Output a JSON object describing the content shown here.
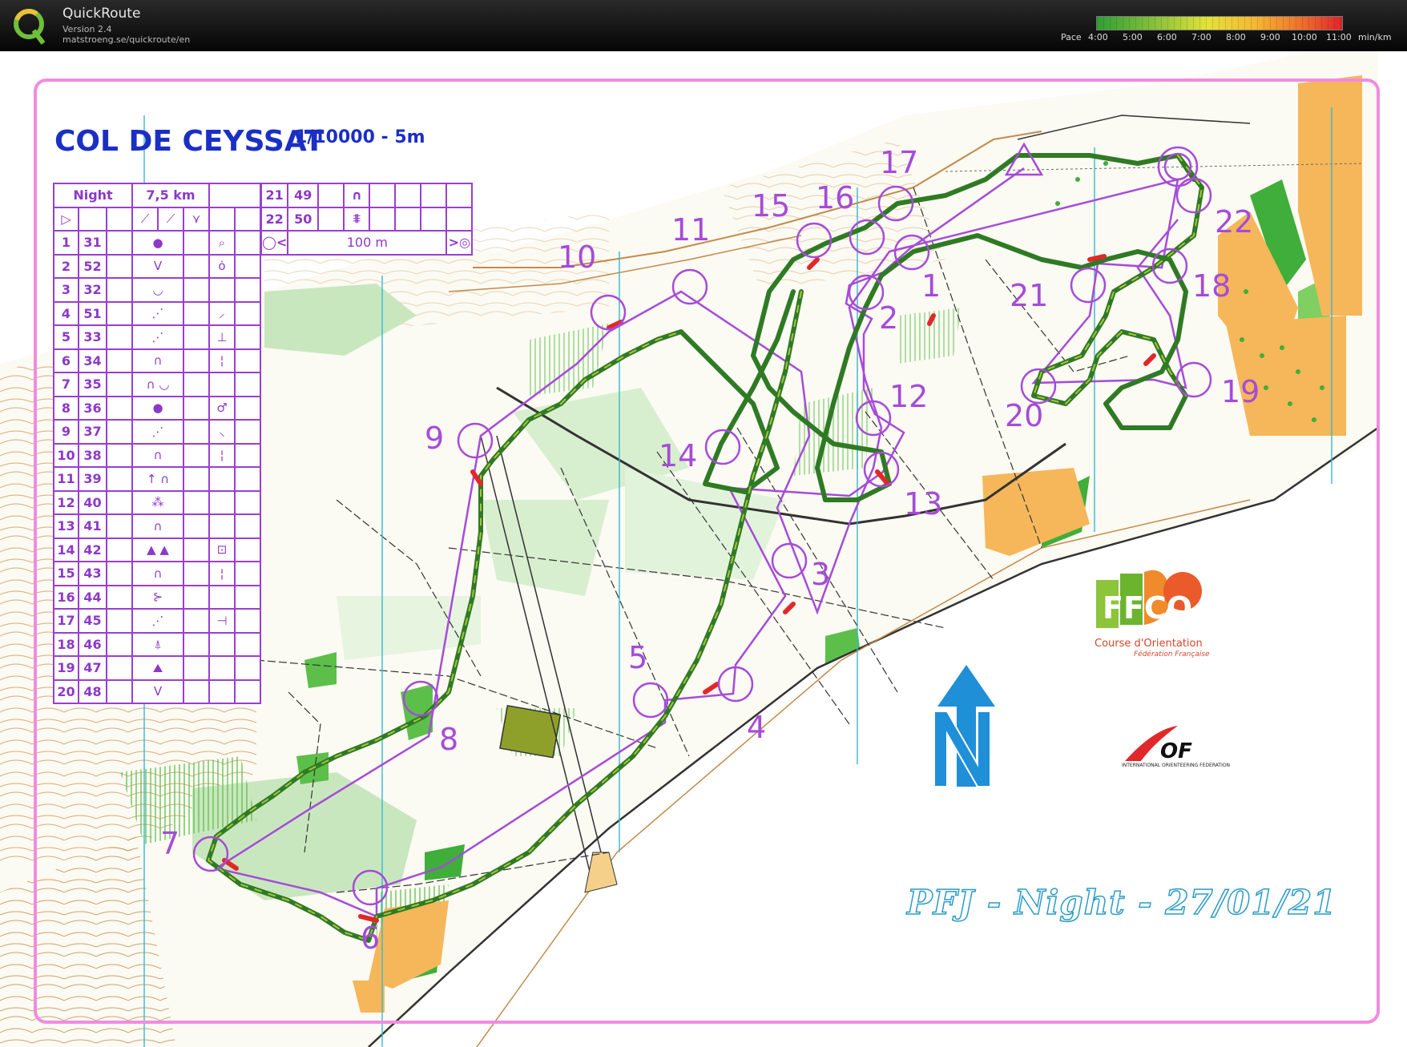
{
  "app": {
    "title": "QuickRoute",
    "version": "Version 2.4",
    "url": "matstroeng.se/quickroute/en",
    "icon": "quickroute-q-logo"
  },
  "pace_scale": {
    "label": "Pace",
    "ticks": [
      "4:00",
      "5:00",
      "6:00",
      "7:00",
      "8:00",
      "9:00",
      "10:00",
      "11:00"
    ],
    "unit": "min/km",
    "colors": [
      "#38a83a",
      "#7cc23a",
      "#b7d63a",
      "#e5e03a",
      "#f6c23a",
      "#f2932f",
      "#ea5a2a",
      "#e0282a"
    ]
  },
  "map": {
    "name": "COL DE CEYSSAT",
    "scale": "1/10000 - 5m",
    "event_title": "PFJ - Night - 27/01/21",
    "course_color": "#a64bd8",
    "route_color": "#2f8a2a",
    "controls": [
      "1",
      "2",
      "3",
      "4",
      "5",
      "6",
      "7",
      "8",
      "9",
      "10",
      "11",
      "12",
      "13",
      "14",
      "15",
      "16",
      "17",
      "18",
      "19",
      "20",
      "21",
      "22"
    ]
  },
  "legend": {
    "class_name": "Night",
    "length": "7,5 km",
    "rows": [
      {
        "num": "1",
        "code": "31",
        "sym": "●",
        "extra": "⌕"
      },
      {
        "num": "2",
        "code": "52",
        "sym": "V",
        "extra": "ȯ"
      },
      {
        "num": "3",
        "code": "32",
        "sym": "◡",
        "extra": ""
      },
      {
        "num": "4",
        "code": "51",
        "sym": "⋰",
        "extra": "⸝"
      },
      {
        "num": "5",
        "code": "33",
        "sym": "⋰",
        "extra": "⊥"
      },
      {
        "num": "6",
        "code": "34",
        "sym": "∩",
        "extra": "¦"
      },
      {
        "num": "7",
        "code": "35",
        "sym": "∩ ◡",
        "extra": ""
      },
      {
        "num": "8",
        "code": "36",
        "sym": "●",
        "extra": "♂"
      },
      {
        "num": "9",
        "code": "37",
        "sym": "⋰",
        "extra": "⸜"
      },
      {
        "num": "10",
        "code": "38",
        "sym": "∩",
        "extra": "¦"
      },
      {
        "num": "11",
        "code": "39",
        "sym": "↑ ∩",
        "extra": ""
      },
      {
        "num": "12",
        "code": "40",
        "sym": "⁂",
        "extra": ""
      },
      {
        "num": "13",
        "code": "41",
        "sym": "∩",
        "extra": ""
      },
      {
        "num": "14",
        "code": "42",
        "sym": "▲ ▲",
        "extra": "⊡"
      },
      {
        "num": "15",
        "code": "43",
        "sym": "∩",
        "extra": "¦"
      },
      {
        "num": "16",
        "code": "44",
        "sym": "⊱",
        "extra": ""
      },
      {
        "num": "17",
        "code": "45",
        "sym": "⋰",
        "extra": "⊣"
      },
      {
        "num": "18",
        "code": "46",
        "sym": "⍋",
        "extra": ""
      },
      {
        "num": "19",
        "code": "47",
        "sym": "⛰",
        "extra": ""
      },
      {
        "num": "20",
        "code": "48",
        "sym": "V",
        "extra": ""
      }
    ],
    "rows2": [
      {
        "num": "21",
        "code": "49",
        "sym": "∩"
      },
      {
        "num": "22",
        "code": "50",
        "sym": "⩨"
      }
    ],
    "finish_distance": "100 m"
  },
  "logos": {
    "ffco_text": "Course d'Orientation",
    "ffco_sub": "Fédération Française",
    "iof_text": "OF",
    "iof_sub": "INTERNATIONAL ORIENTEERING FEDERATION"
  }
}
